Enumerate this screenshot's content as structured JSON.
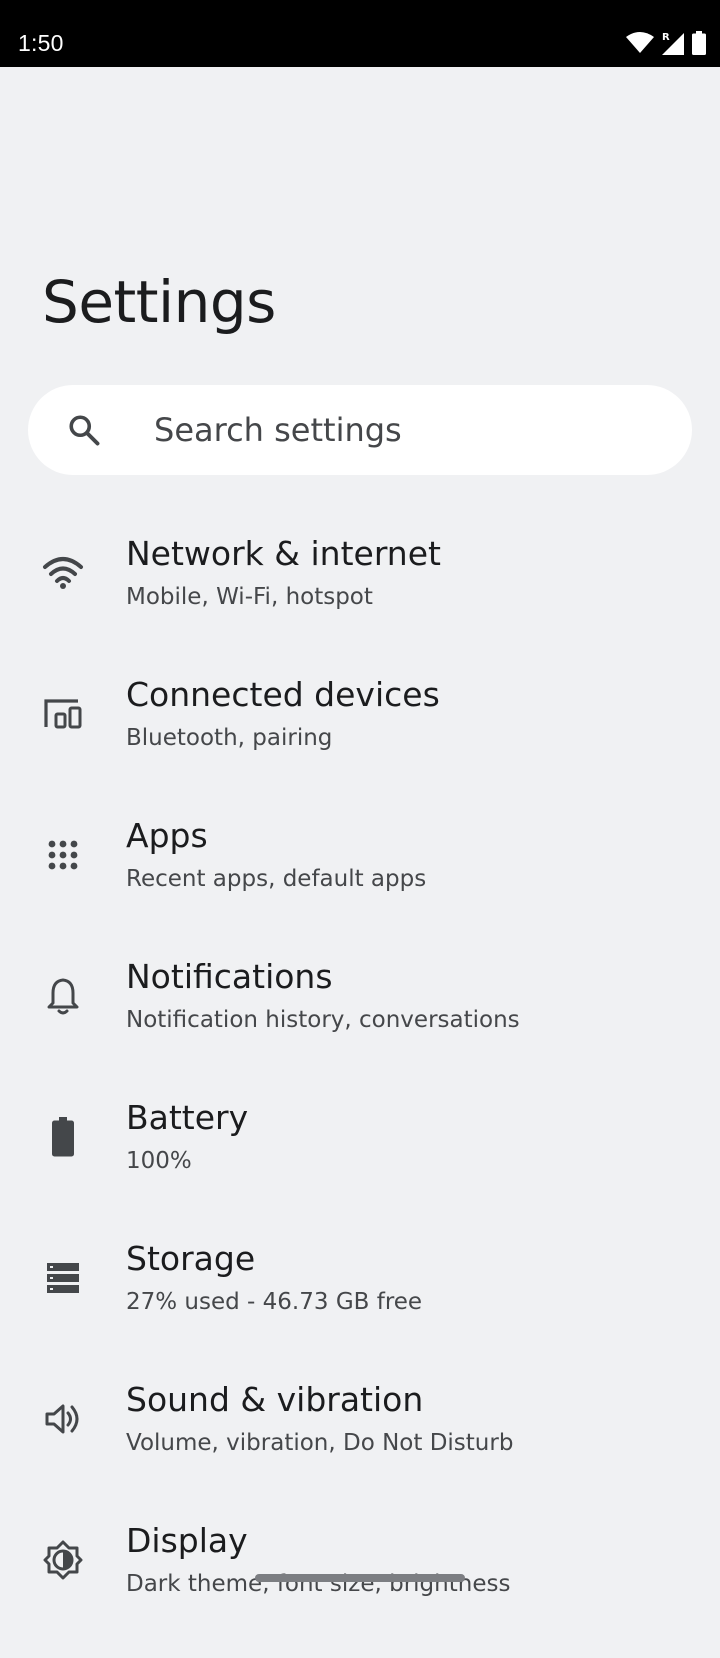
{
  "status_bar": {
    "time": "1:50",
    "icons": [
      "wifi-icon",
      "cell-signal-roaming-icon",
      "battery-icon"
    ]
  },
  "page": {
    "title": "Settings"
  },
  "search": {
    "placeholder": "Search settings"
  },
  "items": [
    {
      "icon": "wifi-icon",
      "title": "Network & internet",
      "subtitle": "Mobile, Wi-Fi, hotspot"
    },
    {
      "icon": "devices-icon",
      "title": "Connected devices",
      "subtitle": "Bluetooth, pairing"
    },
    {
      "icon": "apps-grid-icon",
      "title": "Apps",
      "subtitle": "Recent apps, default apps"
    },
    {
      "icon": "bell-icon",
      "title": "Notifications",
      "subtitle": "Notification history, conversations"
    },
    {
      "icon": "battery-icon",
      "title": "Battery",
      "subtitle": "100%"
    },
    {
      "icon": "storage-icon",
      "title": "Storage",
      "subtitle": "27% used - 46.73 GB free"
    },
    {
      "icon": "volume-icon",
      "title": "Sound & vibration",
      "subtitle": "Volume, vibration, Do Not Disturb"
    },
    {
      "icon": "display-brightness-icon",
      "title": "Display",
      "subtitle": "Dark theme, font size, brightness"
    }
  ],
  "colors": {
    "background": "#f0f1f3",
    "status_bar": "#000000",
    "search_bg": "#ffffff",
    "text_primary": "#1b1c1e",
    "text_secondary": "#45474a",
    "icon": "#44474a"
  }
}
